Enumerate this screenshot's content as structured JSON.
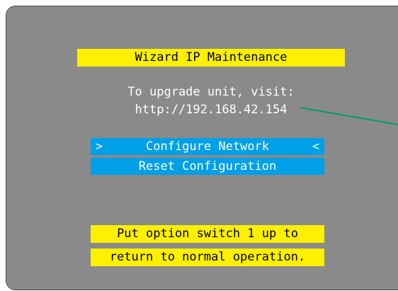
{
  "screen": {
    "title": "Wizard IP Maintenance",
    "info_line1": "To upgrade unit, visit:",
    "info_line2": "http://192.168.42.154",
    "menu": [
      {
        "label": "Configure Network",
        "selected": true,
        "left_marker": ">",
        "right_marker": "<"
      },
      {
        "label": "Reset Configuration",
        "selected": false
      }
    ],
    "note_line1": "Put option switch 1 up to",
    "note_line2": "return to normal operation."
  },
  "colors": {
    "screen_bg": "#8a8a8a",
    "highlight_yellow": "#ffef00",
    "menu_blue": "#00a0e9",
    "pointer_line": "#00a060"
  }
}
